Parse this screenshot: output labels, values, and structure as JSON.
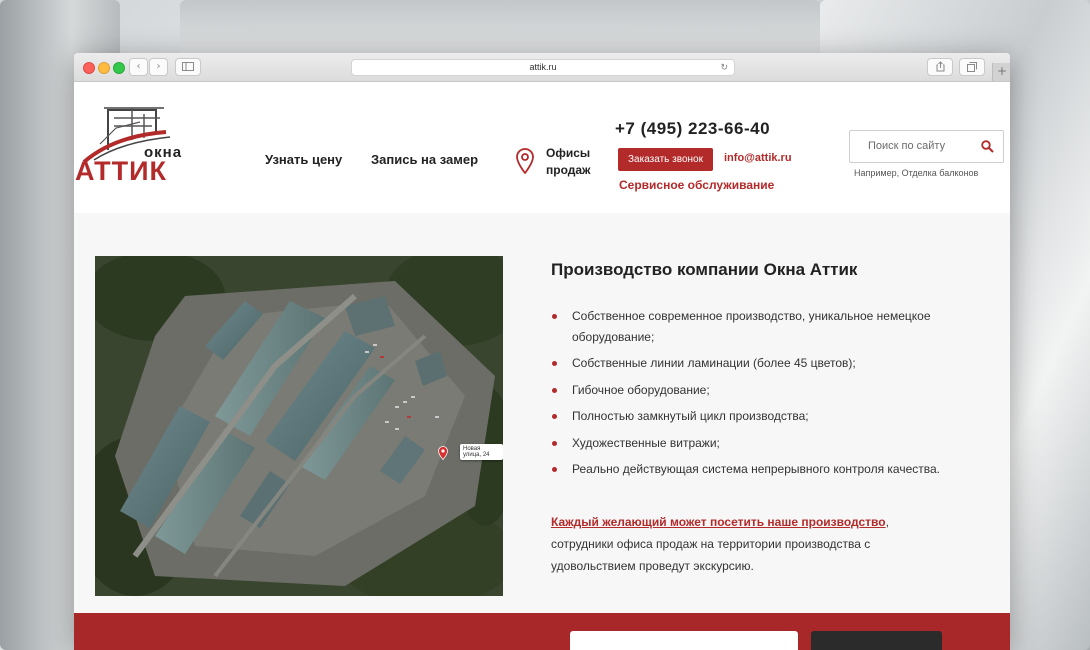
{
  "browser": {
    "url": "attik.ru",
    "back_label": "‹",
    "forward_label": "›",
    "reload_label": "↻",
    "plus_label": "+"
  },
  "header": {
    "logo_small": "окна",
    "logo_big": "АТТИК",
    "nav": {
      "price": "Узнать цену",
      "measure": "Запись на замер"
    },
    "offices_line1": "Офисы",
    "offices_line2": "продаж",
    "phone": "+7 (495) 223-66-40",
    "callback_label": "Заказать звонок",
    "email": "info@attik.ru",
    "service": "Сервисное обслуживание",
    "search_placeholder": "Поиск по сайту",
    "search_hint": "Например, Отделка балконов"
  },
  "main": {
    "map_label": "Новая улица, 24",
    "title": "Производство компании Окна Аттик",
    "features": [
      "Собственное современное производство, уникальное немецкое оборудование;",
      "Собственные линии ламинации (более 45 цветов);",
      "Гибочное оборудование;",
      "Полностью замкнутый цикл производства;",
      "Художественные витражи;",
      "Реально действующая система непрерывного контроля качества."
    ],
    "visit_link": "Каждый желающий может посетить наше производство",
    "visit_rest": ", сотрудники офиса продаж на территории производства с удовольствием проведут экскурсию."
  },
  "colors": {
    "accent": "#b32a2a",
    "footer_bar": "#a8282a"
  }
}
